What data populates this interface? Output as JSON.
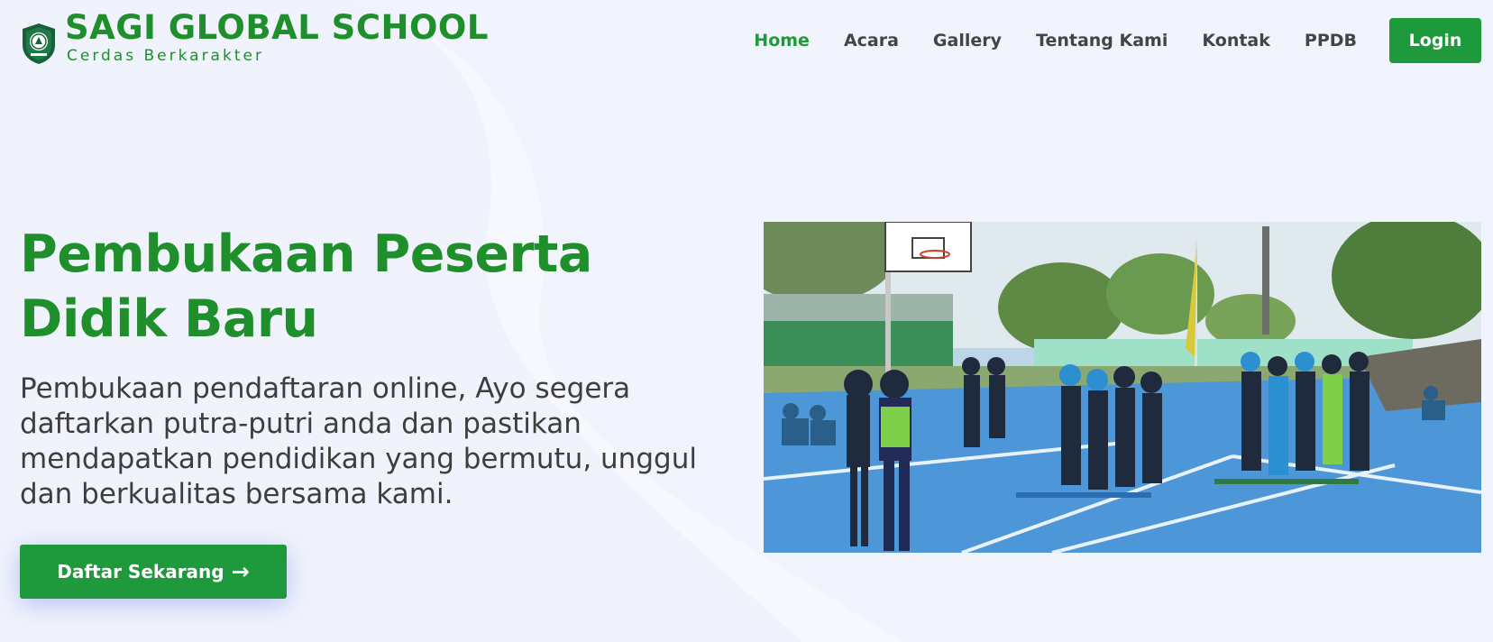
{
  "brand": {
    "name": "SAGI GLOBAL SCHOOL",
    "tagline": "Cerdas Berkarakter",
    "logo_icon": "school-crest-icon",
    "color": "#1f8f2c"
  },
  "nav": {
    "items": [
      {
        "label": "Home",
        "active": true
      },
      {
        "label": "Acara",
        "active": false
      },
      {
        "label": "Gallery",
        "active": false
      },
      {
        "label": "Tentang Kami",
        "active": false
      },
      {
        "label": "Kontak",
        "active": false
      },
      {
        "label": "PPDB",
        "active": false
      }
    ],
    "login_label": "Login"
  },
  "hero": {
    "title": "Pembukaan Peserta Didik Baru",
    "description": "Pembukaan pendaftaran online, Ayo segera daftarkan putra-putri anda dan pastikan mendapatkan pendidikan yang bermutu, unggul dan berkualitas bersama kami.",
    "cta_label": "Daftar Sekarang",
    "cta_icon": "arrow-right-icon"
  },
  "colors": {
    "accent": "#1e9a3c",
    "background": "#f1f4fd"
  }
}
